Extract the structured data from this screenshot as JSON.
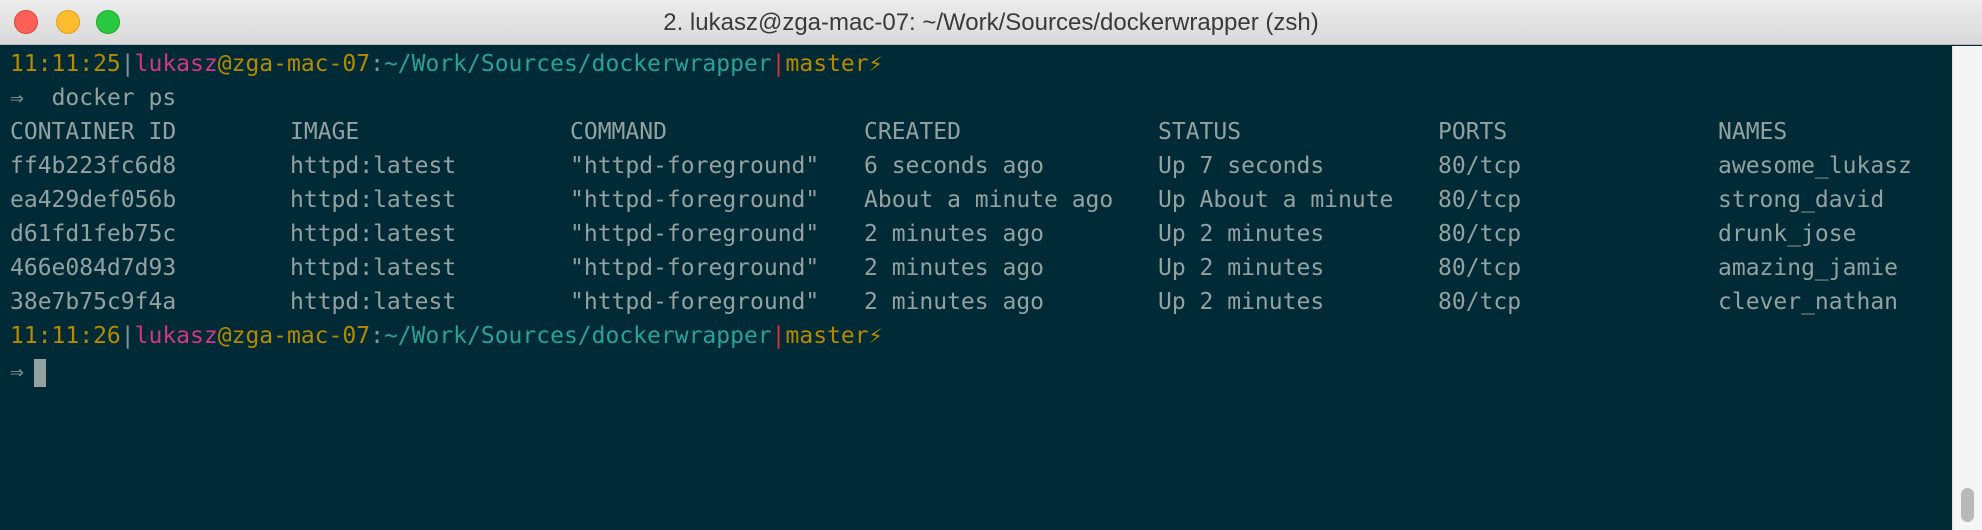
{
  "window": {
    "title": "2. lukasz@zga-mac-07: ~/Work/Sources/dockerwrapper (zsh)"
  },
  "icons": {
    "close": "close-button-red-circle",
    "minimize": "minimize-button-yellow-circle",
    "zoom": "zoom-button-green-circle",
    "bolt": "lightning-bolt-icon"
  },
  "colors": {
    "background": "#002b36",
    "time": "#b58900",
    "user": "#d33682",
    "path": "#2aa198",
    "branch": "#b58900",
    "text": "#93a1a1"
  },
  "terminal": {
    "prompt1": {
      "time": "11:11:25",
      "sep1": "|",
      "user": "lukasz",
      "at": "@",
      "host": "zga-mac-07",
      "colon": ":",
      "path": "~/Work/Sources/dockerwrapper",
      "sep2": "|",
      "branch": "master",
      "bolt": "⚡"
    },
    "command1": {
      "arrow": "⇒",
      "text": "docker ps"
    },
    "headers": [
      "CONTAINER ID",
      "IMAGE",
      "COMMAND",
      "CREATED",
      "STATUS",
      "PORTS",
      "NAMES"
    ],
    "rows": [
      [
        "ff4b223fc6d8",
        "httpd:latest",
        "\"httpd-foreground\"",
        "6 seconds ago",
        "Up 7 seconds",
        "80/tcp",
        "awesome_lukasz"
      ],
      [
        "ea429def056b",
        "httpd:latest",
        "\"httpd-foreground\"",
        "About a minute ago",
        "Up About a minute",
        "80/tcp",
        "strong_david"
      ],
      [
        "d61fd1feb75c",
        "httpd:latest",
        "\"httpd-foreground\"",
        "2 minutes ago",
        "Up 2 minutes",
        "80/tcp",
        "drunk_jose"
      ],
      [
        "466e084d7d93",
        "httpd:latest",
        "\"httpd-foreground\"",
        "2 minutes ago",
        "Up 2 minutes",
        "80/tcp",
        "amazing_jamie"
      ],
      [
        "38e7b75c9f4a",
        "httpd:latest",
        "\"httpd-foreground\"",
        "2 minutes ago",
        "Up 2 minutes",
        "80/tcp",
        "clever_nathan"
      ]
    ],
    "prompt2": {
      "time": "11:11:26",
      "sep1": "|",
      "user": "lukasz",
      "at": "@",
      "host": "zga-mac-07",
      "colon": ":",
      "path": "~/Work/Sources/dockerwrapper",
      "sep2": "|",
      "branch": "master",
      "bolt": "⚡"
    },
    "command2": {
      "arrow": "⇒",
      "text": ""
    }
  }
}
